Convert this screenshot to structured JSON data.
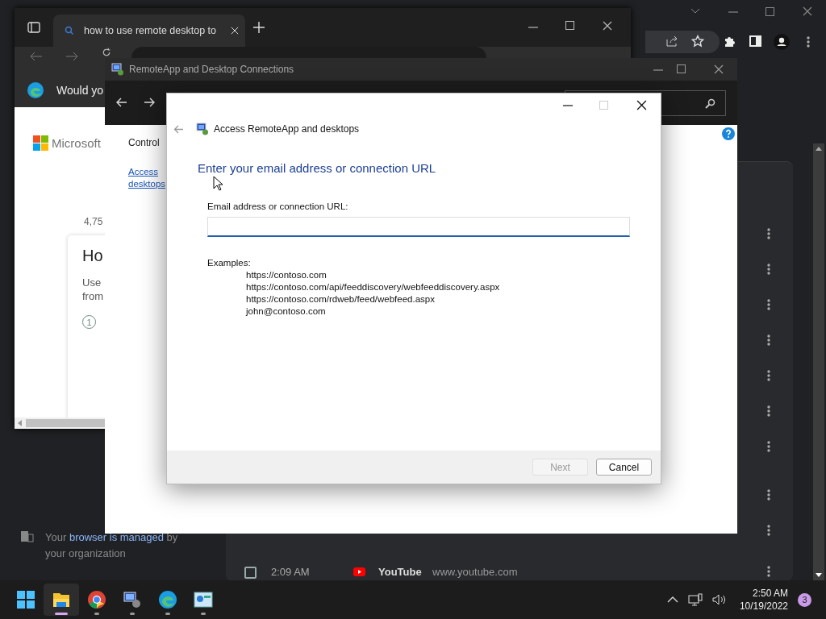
{
  "chrome": {
    "managed_notice": {
      "before": "Your",
      "link": "browser is managed",
      "after": "by your organization"
    },
    "history_row": {
      "checked": false,
      "time": "2:09 AM",
      "title": "YouTube",
      "url": "www.youtube.com"
    }
  },
  "edge": {
    "tab": {
      "title": "how to use remote desktop to",
      "selected": true
    },
    "banner": "Would yo",
    "page": {
      "logo": "Microsoft",
      "count": "4,75",
      "card_title": "Ho",
      "card_text": [
        "Use",
        "from"
      ],
      "step": "1"
    }
  },
  "control_panel": {
    "title": "RemoteApp and Desktop Connections",
    "breadcrumb": "Control",
    "link": [
      "Access",
      "desktops"
    ]
  },
  "dialog": {
    "title": "Access RemoteApp and desktops",
    "heading": "Enter your email address or connection URL",
    "field_label": "Email address or connection URL:",
    "examples_label": "Examples:",
    "examples": [
      "https://contoso.com",
      "https://contoso.com/api/feeddiscovery/webfeeddiscovery.aspx",
      "https://contoso.com/rdweb/feed/webfeed.aspx",
      "john@contoso.com"
    ],
    "buttons": [
      {
        "label": "Next",
        "disabled": true
      },
      {
        "label": "Cancel",
        "disabled": false
      }
    ]
  },
  "taskbar": {
    "apps": [
      {
        "kind": "explorer",
        "selected": true
      },
      {
        "kind": "chrome",
        "selected": false
      },
      {
        "kind": "remote",
        "selected": false
      },
      {
        "kind": "edge",
        "selected": false
      },
      {
        "kind": "panel",
        "selected": false
      }
    ],
    "time": "2:50 AM",
    "date": "10/19/2022",
    "notifications": "3"
  }
}
